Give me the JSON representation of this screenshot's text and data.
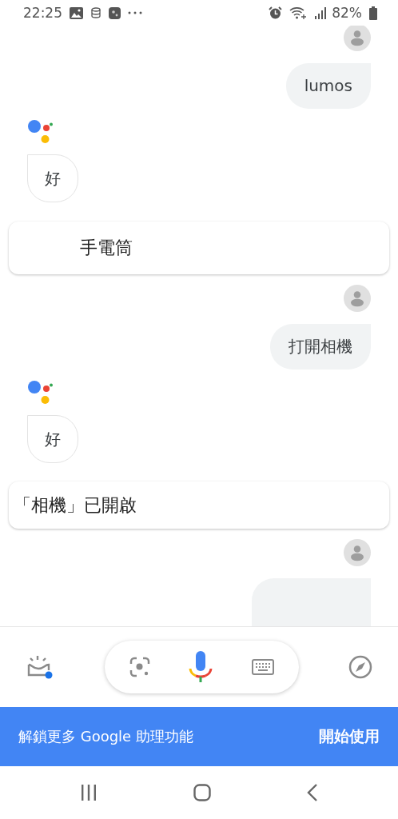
{
  "status_bar": {
    "time": "22:25",
    "battery": "82%"
  },
  "messages": [
    {
      "kind": "user_cut_top",
      "text": "lumos"
    },
    {
      "kind": "assistant",
      "text": "好"
    },
    {
      "kind": "tile",
      "text": "手電筒"
    },
    {
      "kind": "user",
      "text": "打開相機"
    },
    {
      "kind": "assistant",
      "text": "好"
    },
    {
      "kind": "card",
      "text": "「相機」已開啟"
    },
    {
      "kind": "user_cut_bottom"
    }
  ],
  "promo_banner": {
    "text": "解鎖更多 Google 助理功能",
    "action": "開始使用"
  }
}
